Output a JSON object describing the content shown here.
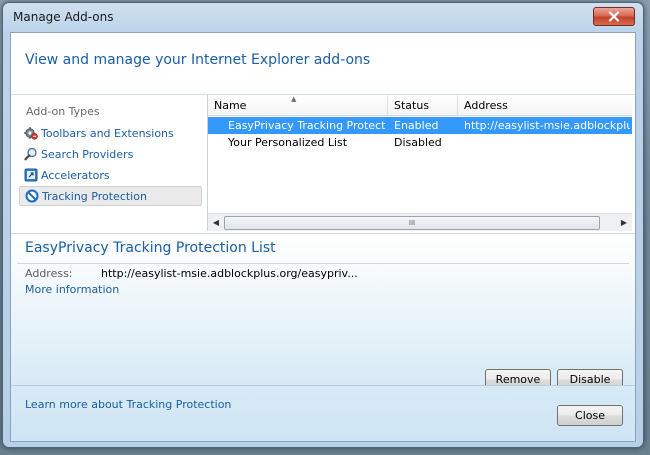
{
  "window": {
    "title": "Manage Add-ons"
  },
  "header": {
    "text": "View and manage your Internet Explorer add-ons"
  },
  "sidebar": {
    "heading": "Add-on Types",
    "items": [
      {
        "label": "Toolbars and Extensions",
        "icon": "gear-icon"
      },
      {
        "label": "Search Providers",
        "icon": "search-icon"
      },
      {
        "label": "Accelerators",
        "icon": "accelerator-icon"
      },
      {
        "label": "Tracking Protection",
        "icon": "tracking-protection-icon",
        "selected": true
      }
    ]
  },
  "list": {
    "columns": [
      "Name",
      "Status",
      "Address"
    ],
    "rows": [
      {
        "name": "EasyPrivacy Tracking Protectio...",
        "status": "Enabled",
        "address": "http://easylist-msie.adblockplus....",
        "selected": true
      },
      {
        "name": "Your Personalized List",
        "status": "Disabled",
        "address": "",
        "selected": false
      }
    ],
    "scroll_thumb_glyph": "III"
  },
  "details": {
    "title": "EasyPrivacy Tracking Protection List",
    "address_label": "Address:",
    "address_value": "http://easylist-msie.adblockplus.org/easypriv...",
    "more_info": "More information",
    "remove_label": "Remove",
    "disable_label": "Disable"
  },
  "footer": {
    "learn_more": "Learn more about Tracking Protection",
    "close_label": "Close"
  },
  "colors": {
    "link_blue": "#1b5ea3",
    "selection_blue": "#3399ff"
  }
}
